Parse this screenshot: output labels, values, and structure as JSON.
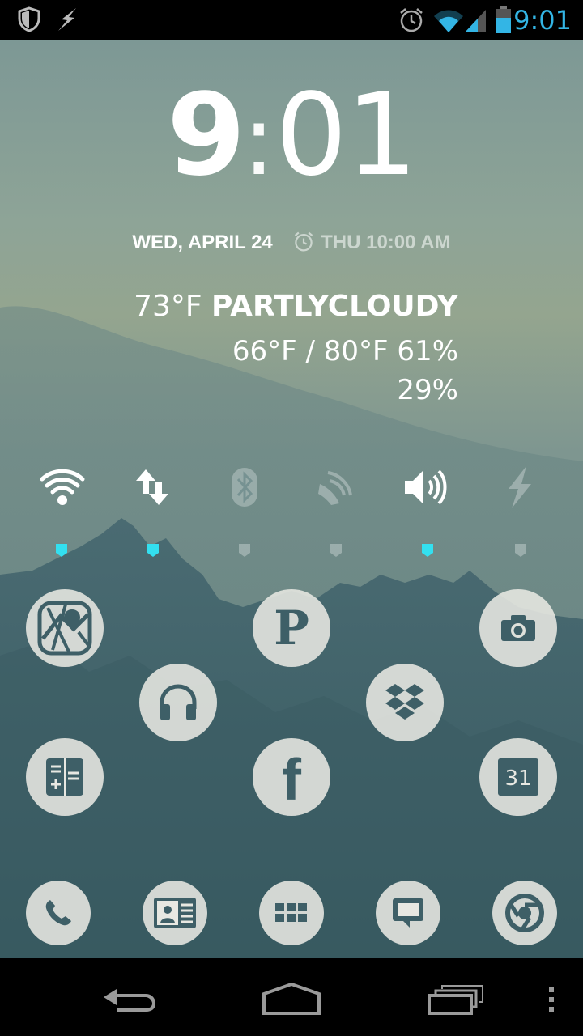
{
  "status_bar": {
    "time": "9:01",
    "left_icons": [
      "shield-icon",
      "lightning-icon"
    ],
    "right_icons": [
      "alarm-icon",
      "wifi-icon",
      "cellular-signal-icon",
      "battery-icon"
    ],
    "accent_color": "#33b5e5"
  },
  "clock_widget": {
    "hour": "9",
    "separator": ":",
    "minutes": "01",
    "date": "WED, APRIL 24",
    "next_alarm": "THU 10:00 AM"
  },
  "weather": {
    "current_temp": "73°F",
    "condition": "PARTLYCLOUDY",
    "low_high_humidity": "66°F / 80°F 61%",
    "precipitation": "29%"
  },
  "power_toggles": [
    {
      "name": "wifi",
      "icon": "wifi-icon",
      "active": true
    },
    {
      "name": "data",
      "icon": "data-arrows-icon",
      "active": true
    },
    {
      "name": "bluetooth",
      "icon": "bluetooth-icon",
      "active": false
    },
    {
      "name": "sync",
      "icon": "sync-icon",
      "active": false
    },
    {
      "name": "sound",
      "icon": "speaker-icon",
      "active": true
    },
    {
      "name": "flash",
      "icon": "flash-icon",
      "active": false
    }
  ],
  "apps": [
    {
      "name": "maps",
      "icon": "maps-icon"
    },
    {
      "name": "pocket",
      "icon": "p-letter-icon",
      "glyph": "P"
    },
    {
      "name": "camera",
      "icon": "camera-icon"
    },
    {
      "name": "music",
      "icon": "headphones-icon"
    },
    {
      "name": "dropbox",
      "icon": "dropbox-icon"
    },
    {
      "name": "calculator",
      "icon": "calculator-icon"
    },
    {
      "name": "facebook",
      "icon": "facebook-icon",
      "glyph": "f"
    },
    {
      "name": "calendar",
      "icon": "calendar-icon",
      "glyph": "31"
    }
  ],
  "dock": [
    {
      "name": "phone",
      "icon": "phone-icon"
    },
    {
      "name": "contacts",
      "icon": "contacts-icon"
    },
    {
      "name": "app-drawer",
      "icon": "app-drawer-icon"
    },
    {
      "name": "messaging",
      "icon": "messaging-icon"
    },
    {
      "name": "chrome",
      "icon": "chrome-icon"
    }
  ],
  "nav_bar": [
    "back-icon",
    "home-icon",
    "recents-icon",
    "menu-icon"
  ]
}
